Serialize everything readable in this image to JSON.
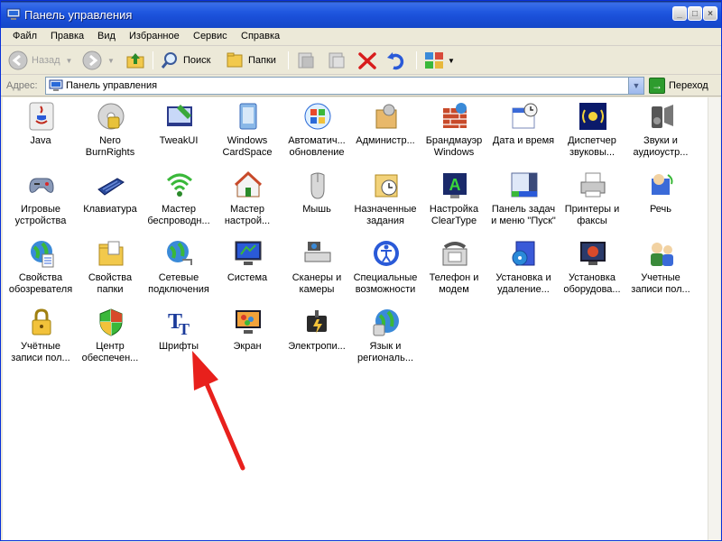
{
  "window": {
    "title": "Панель управления"
  },
  "title_buttons": {
    "min": "_",
    "max": "□",
    "close": "×"
  },
  "menu": [
    "Файл",
    "Правка",
    "Вид",
    "Избранное",
    "Сервис",
    "Справка"
  ],
  "toolbar": {
    "back": "Назад",
    "search": "Поиск",
    "folders": "Папки"
  },
  "address": {
    "label": "Адрес:",
    "value": "Панель управления",
    "go": "Переход"
  },
  "items": [
    {
      "label": "Java",
      "icon": "java-icon"
    },
    {
      "label": "Nero BurnRights",
      "icon": "nero-burnrights-icon"
    },
    {
      "label": "TweakUI",
      "icon": "tweakui-icon"
    },
    {
      "label": "Windows CardSpace",
      "icon": "cardspace-icon"
    },
    {
      "label": "Автоматич... обновление",
      "icon": "windows-update-icon"
    },
    {
      "label": "Администр...",
      "icon": "administrative-tools-icon"
    },
    {
      "label": "Брандмауэр Windows",
      "icon": "firewall-icon"
    },
    {
      "label": "Дата и время",
      "icon": "date-time-icon"
    },
    {
      "label": "Диспетчер звуковы...",
      "icon": "sound-manager-icon"
    },
    {
      "label": "Звуки и аудиоустр...",
      "icon": "sounds-audio-icon"
    },
    {
      "label": "Игровые устройства",
      "icon": "game-controllers-icon"
    },
    {
      "label": "Клавиатура",
      "icon": "keyboard-icon"
    },
    {
      "label": "Мастер беспроводн...",
      "icon": "wireless-wizard-icon"
    },
    {
      "label": "Мастер настрой...",
      "icon": "setup-wizard-icon"
    },
    {
      "label": "Мышь",
      "icon": "mouse-icon"
    },
    {
      "label": "Назначенные задания",
      "icon": "scheduled-tasks-icon"
    },
    {
      "label": "Настройка ClearType",
      "icon": "cleartype-icon"
    },
    {
      "label": "Панель задач и меню \"Пуск\"",
      "icon": "taskbar-start-icon"
    },
    {
      "label": "Принтеры и факсы",
      "icon": "printers-faxes-icon"
    },
    {
      "label": "Речь",
      "icon": "speech-icon"
    },
    {
      "label": "Свойства обозревателя",
      "icon": "internet-options-icon"
    },
    {
      "label": "Свойства папки",
      "icon": "folder-options-icon"
    },
    {
      "label": "Сетевые подключения",
      "icon": "network-connections-icon"
    },
    {
      "label": "Система",
      "icon": "system-icon"
    },
    {
      "label": "Сканеры и камеры",
      "icon": "scanners-cameras-icon"
    },
    {
      "label": "Специальные возможности",
      "icon": "accessibility-icon"
    },
    {
      "label": "Телефон и модем",
      "icon": "phone-modem-icon"
    },
    {
      "label": "Установка и удаление...",
      "icon": "add-remove-programs-icon"
    },
    {
      "label": "Установка оборудова...",
      "icon": "add-hardware-icon"
    },
    {
      "label": "Учетные записи пол...",
      "icon": "user-accounts-icon"
    },
    {
      "label": "Учётные записи пол...",
      "icon": "user-accounts-lock-icon"
    },
    {
      "label": "Центр обеспечен...",
      "icon": "security-center-icon"
    },
    {
      "label": "Шрифты",
      "icon": "fonts-icon"
    },
    {
      "label": "Экран",
      "icon": "display-icon"
    },
    {
      "label": "Электропи...",
      "icon": "power-options-icon"
    },
    {
      "label": "Язык и региональ...",
      "icon": "regional-language-icon"
    }
  ],
  "colors": {
    "titlebar": "#1f55d8",
    "annotation_arrow": "#e8201c"
  }
}
